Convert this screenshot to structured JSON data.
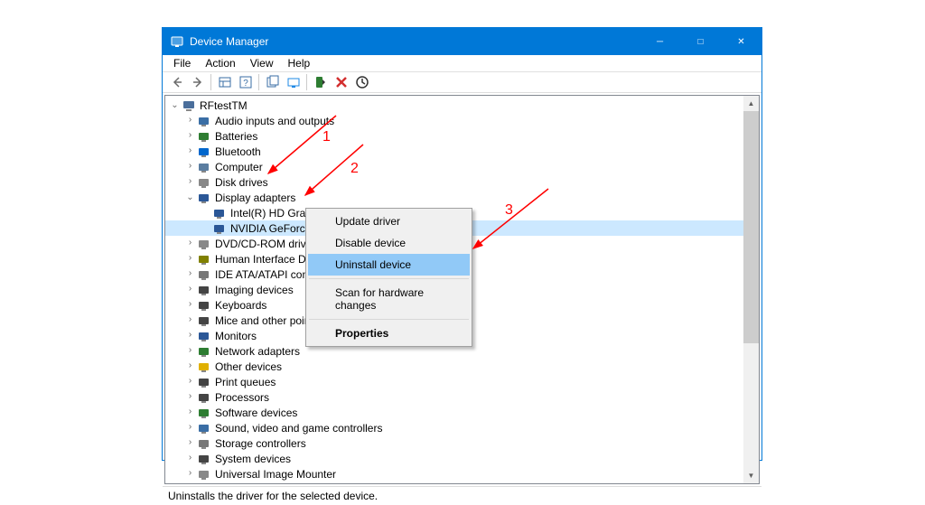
{
  "window": {
    "title": "Device Manager"
  },
  "menu": {
    "file": "File",
    "action": "Action",
    "view": "View",
    "help": "Help"
  },
  "tree": {
    "root": "RFtestTM",
    "items": [
      {
        "label": "Audio inputs and outputs",
        "iconColor": "#3a6ea5",
        "expanded": false
      },
      {
        "label": "Batteries",
        "iconColor": "#2e7d32",
        "expanded": false
      },
      {
        "label": "Bluetooth",
        "iconColor": "#0066cc",
        "expanded": false
      },
      {
        "label": "Computer",
        "iconColor": "#5a7da0",
        "expanded": false
      },
      {
        "label": "Disk drives",
        "iconColor": "#888888",
        "expanded": false
      },
      {
        "label": "Display adapters",
        "iconColor": "#2b5797",
        "expanded": true,
        "children": [
          {
            "label": "Intel(R) HD Graphics",
            "iconColor": "#2b5797"
          },
          {
            "label": "NVIDIA GeForce",
            "iconColor": "#2b5797",
            "selected": true,
            "truncated": true
          }
        ]
      },
      {
        "label": "DVD/CD-ROM drives",
        "iconColor": "#888888",
        "expanded": false,
        "truncated": true
      },
      {
        "label": "Human Interface Dev",
        "iconColor": "#808000",
        "expanded": false,
        "truncated": true
      },
      {
        "label": "IDE ATA/ATAPI contro",
        "iconColor": "#777777",
        "expanded": false,
        "truncated": true
      },
      {
        "label": "Imaging devices",
        "iconColor": "#444444",
        "expanded": false
      },
      {
        "label": "Keyboards",
        "iconColor": "#444444",
        "expanded": false
      },
      {
        "label": "Mice and other point",
        "iconColor": "#444444",
        "expanded": false,
        "truncated": true
      },
      {
        "label": "Monitors",
        "iconColor": "#2b5797",
        "expanded": false
      },
      {
        "label": "Network adapters",
        "iconColor": "#2e7d32",
        "expanded": false
      },
      {
        "label": "Other devices",
        "iconColor": "#e0b000",
        "expanded": false
      },
      {
        "label": "Print queues",
        "iconColor": "#444444",
        "expanded": false
      },
      {
        "label": "Processors",
        "iconColor": "#444444",
        "expanded": false
      },
      {
        "label": "Software devices",
        "iconColor": "#2e7d32",
        "expanded": false
      },
      {
        "label": "Sound, video and game controllers",
        "iconColor": "#3a6ea5",
        "expanded": false
      },
      {
        "label": "Storage controllers",
        "iconColor": "#777777",
        "expanded": false
      },
      {
        "label": "System devices",
        "iconColor": "#444444",
        "expanded": false
      },
      {
        "label": "Universal Image Mounter",
        "iconColor": "#888888",
        "expanded": false
      }
    ]
  },
  "context_menu": {
    "update": "Update driver",
    "disable": "Disable device",
    "uninstall": "Uninstall device",
    "scan": "Scan for hardware changes",
    "properties": "Properties"
  },
  "statusbar": {
    "text": "Uninstalls the driver for the selected device."
  },
  "annotations": {
    "n1": "1",
    "n2": "2",
    "n3": "3"
  }
}
